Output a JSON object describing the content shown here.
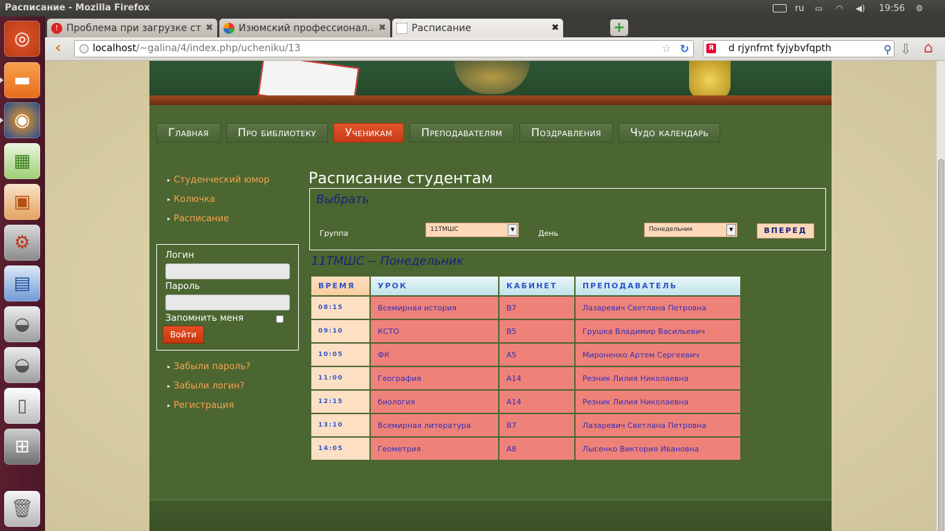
{
  "system": {
    "window_title": "Расписание - Mozilla Firefox",
    "keyboard_layout": "ru",
    "clock": "19:56"
  },
  "browser": {
    "tabs": [
      {
        "title": "Проблема при загрузке ст...",
        "active": false
      },
      {
        "title": "Изюмский профессионал...",
        "active": false
      },
      {
        "title": "Расписание",
        "active": true
      }
    ],
    "url_host": "localhost",
    "url_path": "/~galina/4/index.php/ucheniku/13",
    "search_text": "d rjynfrnt fyjybvfqpth",
    "search_engine_letter": "Я"
  },
  "menu": [
    {
      "label": "Главная",
      "active": false
    },
    {
      "label": "Про библиотеку",
      "active": false
    },
    {
      "label": "Ученикам",
      "active": true
    },
    {
      "label": "Преподавателям",
      "active": false
    },
    {
      "label": "Поздравления",
      "active": false
    },
    {
      "label": "Чудо календарь",
      "active": false
    }
  ],
  "sidebar": {
    "links": [
      "Студенческий юмор",
      "Колючка",
      "Расписание"
    ],
    "login": {
      "login_label": "Логин",
      "password_label": "Пароль",
      "remember_label": "Запомнить меня",
      "submit_label": "Войти"
    },
    "account_links": [
      "Забыли пароль?",
      "Забыли логин?",
      "Регистрация"
    ]
  },
  "main": {
    "page_title": "Расписание студентам",
    "select_title": "Выбрать",
    "group_label": "Группа",
    "group_value": "11ТМШС",
    "day_label": "День",
    "day_value": "Понедельник",
    "forward_label": "ВПЕРЕД",
    "schedule_heading": "11ТМШС -- Понедельник"
  },
  "table": {
    "headers": [
      "ВРЕМЯ",
      "УРОК",
      "КАБИНЕТ",
      "ПРЕПОДАВАТЕЛЬ"
    ],
    "rows": [
      [
        "08:15",
        "Всемирная история",
        "B7",
        "Лазаревич Светлана Петровна"
      ],
      [
        "09:10",
        "КСТО",
        "B5",
        "Грушка Владимир Васильевич"
      ],
      [
        "10:05",
        "ФК",
        "A5",
        "Мироненко Артем Сергеевич"
      ],
      [
        "11:00",
        "География",
        "A14",
        "Резник Лилия Николаевна"
      ],
      [
        "12:15",
        "биология",
        "A14",
        "Резник Лилия Николаевна"
      ],
      [
        "13:10",
        "Всемирная литература",
        "B7",
        "Лазаревич Светлана Петровна"
      ],
      [
        "14:05",
        "Геометрия",
        "A8",
        "Лысенко Виктория Ивановна"
      ]
    ]
  }
}
